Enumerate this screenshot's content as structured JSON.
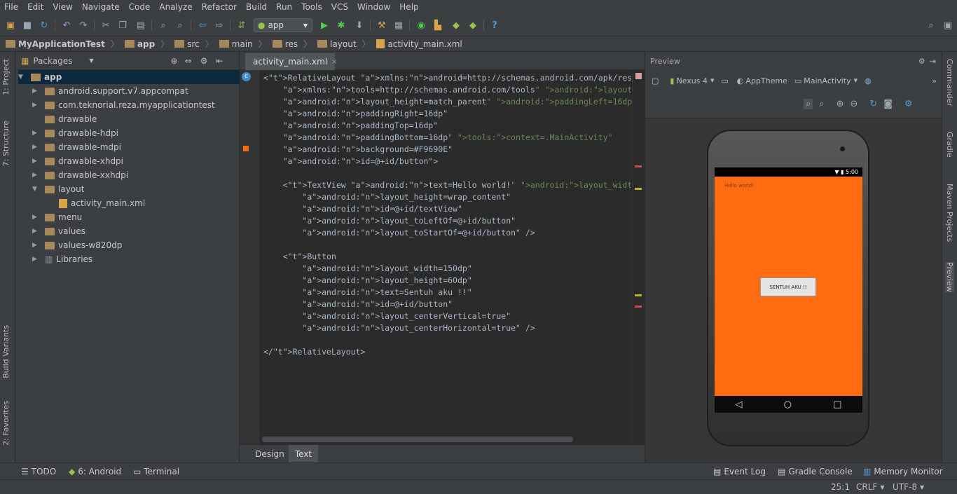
{
  "menu": [
    "File",
    "Edit",
    "View",
    "Navigate",
    "Code",
    "Analyze",
    "Refactor",
    "Build",
    "Run",
    "Tools",
    "VCS",
    "Window",
    "Help"
  ],
  "toolbar": {
    "run_config": "app",
    "help_label": "?"
  },
  "breadcrumbs": [
    "MyApplicationTest",
    "app",
    "src",
    "main",
    "res",
    "layout",
    "activity_main.xml"
  ],
  "project_panel": {
    "view_mode": "Packages",
    "tree": [
      {
        "label": "app",
        "expanded": true
      },
      {
        "label": "android.support.v7.appcompat"
      },
      {
        "label": "com.teknorial.reza.myapplicationtest"
      },
      {
        "label": "drawable"
      },
      {
        "label": "drawable-hdpi"
      },
      {
        "label": "drawable-mdpi"
      },
      {
        "label": "drawable-xhdpi"
      },
      {
        "label": "drawable-xxhdpi"
      },
      {
        "label": "layout",
        "expanded": true
      },
      {
        "label": "activity_main.xml"
      },
      {
        "label": "menu"
      },
      {
        "label": "values"
      },
      {
        "label": "values-w820dp"
      },
      {
        "label": "Libraries"
      }
    ]
  },
  "left_tabs": [
    "1: Project",
    "7: Structure",
    "Build Variants",
    "2: Favorites"
  ],
  "right_tabs": [
    "Commander",
    "Gradle",
    "Maven Projects",
    "Preview"
  ],
  "editor": {
    "tab_label": "activity_main.xml",
    "lines": [
      "<RelativeLayout xmlns:android=\"http://schemas.android.com/apk/res/android\"",
      "    xmlns:tools=\"http://schemas.android.com/tools\" android:layout_width=\"match_parent\"",
      "    android:layout_height=\"match_parent\" android:paddingLeft=\"16dp\"",
      "    android:paddingRight=\"16dp\"",
      "    android:paddingTop=\"16dp\"",
      "    android:paddingBottom=\"16dp\" tools:context=\".MainActivity\"",
      "    android:background=\"#F9690E\"",
      "    android:id=\"@+id/button\">",
      "",
      "    <TextView android:text=\"Hello world!\" android:layout_width=\"wrap_content\"",
      "        android:layout_height=\"wrap_content\"",
      "        android:id=\"@+id/textView\"",
      "        android:layout_toLeftOf=\"@+id/button\"",
      "        android:layout_toStartOf=\"@+id/button\" />",
      "",
      "    <Button",
      "        android:layout_width=\"150dp\"",
      "        android:layout_height=\"60dp\"",
      "        android:text=\"Sentuh aku !!\"",
      "        android:id=\"@+id/button\"",
      "        android:layout_centerVertical=\"true\"",
      "        android:layout_centerHorizontal=\"true\" />",
      "",
      "</RelativeLayout>"
    ],
    "bottom_tabs": [
      "Design",
      "Text"
    ],
    "active_bottom_tab": "Text"
  },
  "preview": {
    "title": "Preview",
    "device": "Nexus 4",
    "theme": "AppTheme",
    "activity": "MainActivity",
    "status_time": "5:00",
    "hello_text": "Hello world!",
    "button_text": "SENTUH AKU !!",
    "background_color": "#F9690E"
  },
  "bottom_tools": {
    "todo": "TODO",
    "android": "6: Android",
    "terminal": "Terminal",
    "event_log": "Event Log",
    "gradle_console": "Gradle Console",
    "memory_monitor": "Memory Monitor"
  },
  "status": {
    "position": "25:1",
    "line_sep": "CRLF",
    "encoding": "UTF-8"
  }
}
